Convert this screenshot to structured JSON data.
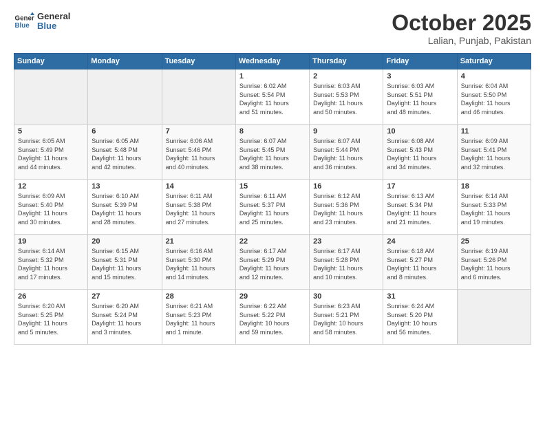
{
  "header": {
    "logo_general": "General",
    "logo_blue": "Blue",
    "month_title": "October 2025",
    "location": "Lalian, Punjab, Pakistan"
  },
  "calendar": {
    "days_of_week": [
      "Sunday",
      "Monday",
      "Tuesday",
      "Wednesday",
      "Thursday",
      "Friday",
      "Saturday"
    ],
    "weeks": [
      [
        {
          "day": "",
          "info": ""
        },
        {
          "day": "",
          "info": ""
        },
        {
          "day": "",
          "info": ""
        },
        {
          "day": "1",
          "info": "Sunrise: 6:02 AM\nSunset: 5:54 PM\nDaylight: 11 hours\nand 51 minutes."
        },
        {
          "day": "2",
          "info": "Sunrise: 6:03 AM\nSunset: 5:53 PM\nDaylight: 11 hours\nand 50 minutes."
        },
        {
          "day": "3",
          "info": "Sunrise: 6:03 AM\nSunset: 5:51 PM\nDaylight: 11 hours\nand 48 minutes."
        },
        {
          "day": "4",
          "info": "Sunrise: 6:04 AM\nSunset: 5:50 PM\nDaylight: 11 hours\nand 46 minutes."
        }
      ],
      [
        {
          "day": "5",
          "info": "Sunrise: 6:05 AM\nSunset: 5:49 PM\nDaylight: 11 hours\nand 44 minutes."
        },
        {
          "day": "6",
          "info": "Sunrise: 6:05 AM\nSunset: 5:48 PM\nDaylight: 11 hours\nand 42 minutes."
        },
        {
          "day": "7",
          "info": "Sunrise: 6:06 AM\nSunset: 5:46 PM\nDaylight: 11 hours\nand 40 minutes."
        },
        {
          "day": "8",
          "info": "Sunrise: 6:07 AM\nSunset: 5:45 PM\nDaylight: 11 hours\nand 38 minutes."
        },
        {
          "day": "9",
          "info": "Sunrise: 6:07 AM\nSunset: 5:44 PM\nDaylight: 11 hours\nand 36 minutes."
        },
        {
          "day": "10",
          "info": "Sunrise: 6:08 AM\nSunset: 5:43 PM\nDaylight: 11 hours\nand 34 minutes."
        },
        {
          "day": "11",
          "info": "Sunrise: 6:09 AM\nSunset: 5:41 PM\nDaylight: 11 hours\nand 32 minutes."
        }
      ],
      [
        {
          "day": "12",
          "info": "Sunrise: 6:09 AM\nSunset: 5:40 PM\nDaylight: 11 hours\nand 30 minutes."
        },
        {
          "day": "13",
          "info": "Sunrise: 6:10 AM\nSunset: 5:39 PM\nDaylight: 11 hours\nand 28 minutes."
        },
        {
          "day": "14",
          "info": "Sunrise: 6:11 AM\nSunset: 5:38 PM\nDaylight: 11 hours\nand 27 minutes."
        },
        {
          "day": "15",
          "info": "Sunrise: 6:11 AM\nSunset: 5:37 PM\nDaylight: 11 hours\nand 25 minutes."
        },
        {
          "day": "16",
          "info": "Sunrise: 6:12 AM\nSunset: 5:36 PM\nDaylight: 11 hours\nand 23 minutes."
        },
        {
          "day": "17",
          "info": "Sunrise: 6:13 AM\nSunset: 5:34 PM\nDaylight: 11 hours\nand 21 minutes."
        },
        {
          "day": "18",
          "info": "Sunrise: 6:14 AM\nSunset: 5:33 PM\nDaylight: 11 hours\nand 19 minutes."
        }
      ],
      [
        {
          "day": "19",
          "info": "Sunrise: 6:14 AM\nSunset: 5:32 PM\nDaylight: 11 hours\nand 17 minutes."
        },
        {
          "day": "20",
          "info": "Sunrise: 6:15 AM\nSunset: 5:31 PM\nDaylight: 11 hours\nand 15 minutes."
        },
        {
          "day": "21",
          "info": "Sunrise: 6:16 AM\nSunset: 5:30 PM\nDaylight: 11 hours\nand 14 minutes."
        },
        {
          "day": "22",
          "info": "Sunrise: 6:17 AM\nSunset: 5:29 PM\nDaylight: 11 hours\nand 12 minutes."
        },
        {
          "day": "23",
          "info": "Sunrise: 6:17 AM\nSunset: 5:28 PM\nDaylight: 11 hours\nand 10 minutes."
        },
        {
          "day": "24",
          "info": "Sunrise: 6:18 AM\nSunset: 5:27 PM\nDaylight: 11 hours\nand 8 minutes."
        },
        {
          "day": "25",
          "info": "Sunrise: 6:19 AM\nSunset: 5:26 PM\nDaylight: 11 hours\nand 6 minutes."
        }
      ],
      [
        {
          "day": "26",
          "info": "Sunrise: 6:20 AM\nSunset: 5:25 PM\nDaylight: 11 hours\nand 5 minutes."
        },
        {
          "day": "27",
          "info": "Sunrise: 6:20 AM\nSunset: 5:24 PM\nDaylight: 11 hours\nand 3 minutes."
        },
        {
          "day": "28",
          "info": "Sunrise: 6:21 AM\nSunset: 5:23 PM\nDaylight: 11 hours\nand 1 minute."
        },
        {
          "day": "29",
          "info": "Sunrise: 6:22 AM\nSunset: 5:22 PM\nDaylight: 10 hours\nand 59 minutes."
        },
        {
          "day": "30",
          "info": "Sunrise: 6:23 AM\nSunset: 5:21 PM\nDaylight: 10 hours\nand 58 minutes."
        },
        {
          "day": "31",
          "info": "Sunrise: 6:24 AM\nSunset: 5:20 PM\nDaylight: 10 hours\nand 56 minutes."
        },
        {
          "day": "",
          "info": ""
        }
      ]
    ]
  }
}
